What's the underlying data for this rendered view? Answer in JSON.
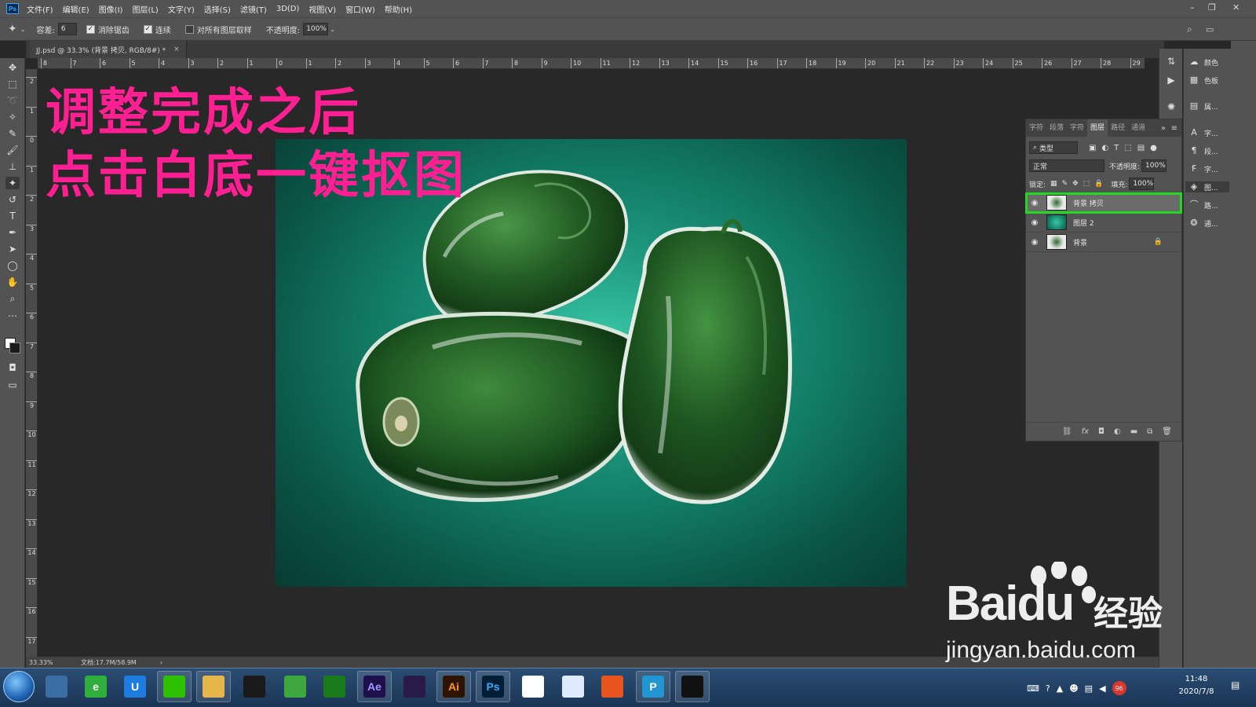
{
  "menubar": {
    "logo": "Ps",
    "items": [
      "文件(F)",
      "编辑(E)",
      "图像(I)",
      "图层(L)",
      "文字(Y)",
      "选择(S)",
      "滤镜(T)",
      "3D(D)",
      "视图(V)",
      "窗口(W)",
      "帮助(H)"
    ]
  },
  "options": {
    "tolerance_label": "容差:",
    "tolerance_value": "6",
    "antialias_label": "消除锯齿",
    "contiguous_label": "连续",
    "sample_all_label": "对所有图层取样",
    "opacity_label": "不透明度:",
    "opacity_value": "100%"
  },
  "document": {
    "tab_title": "JJ.psd @ 33.3% (背景 拷贝, RGB/8#) *",
    "close": "×",
    "zoom": "33.33%",
    "doc_size": "文档:17.7M/58.9M"
  },
  "rulers": {
    "top": [
      "8",
      "7",
      "6",
      "5",
      "4",
      "3",
      "2",
      "1",
      "0",
      "1",
      "2",
      "3",
      "4",
      "5",
      "6",
      "7",
      "8",
      "9",
      "10",
      "11",
      "12",
      "13",
      "14",
      "15",
      "16",
      "17",
      "18",
      "19",
      "20",
      "21",
      "22",
      "23",
      "24",
      "25",
      "26",
      "27",
      "28",
      "29"
    ],
    "left": [
      "2",
      "1",
      "0",
      "1",
      "2",
      "3",
      "4",
      "5",
      "6",
      "7",
      "8",
      "9",
      "10",
      "11",
      "12",
      "13",
      "14",
      "15",
      "16",
      "17"
    ]
  },
  "overlay": {
    "line1": "调整完成之后",
    "line2": "点击白底一键抠图",
    "color": "#ff1f92"
  },
  "right_panels": [
    {
      "label": "颜色",
      "icon": "palette-icon"
    },
    {
      "label": "色板",
      "icon": "grid-icon"
    },
    {
      "label": "属...",
      "icon": "properties-icon"
    },
    {
      "label": "字...",
      "icon": "character-icon"
    },
    {
      "label": "段...",
      "icon": "paragraph-icon"
    },
    {
      "label": "字...",
      "icon": "glyphs-icon"
    },
    {
      "label": "图...",
      "icon": "layers-icon"
    },
    {
      "label": "路...",
      "icon": "paths-icon"
    },
    {
      "label": "通...",
      "icon": "channels-icon"
    }
  ],
  "layers_panel": {
    "tabs": [
      "字符",
      "段落",
      "字符",
      "图层",
      "路径",
      "通道"
    ],
    "active_tab": "图层",
    "filter_kind": "类型",
    "blend_mode": "正常",
    "opacity_label": "不透明度:",
    "opacity_value": "100%",
    "lock_label": "锁定:",
    "fill_label": "填充:",
    "fill_value": "100%",
    "layers": [
      {
        "name": "背景 拷贝",
        "selected": true,
        "locked": false
      },
      {
        "name": "图层 2",
        "selected": false,
        "locked": false
      },
      {
        "name": "背景",
        "selected": false,
        "locked": true
      }
    ],
    "footer_icons": [
      "link-icon",
      "fx-icon",
      "mask-icon",
      "adjustment-icon",
      "folder-icon",
      "new-layer-icon",
      "trash-icon"
    ],
    "highlight_color": "#22d822"
  },
  "watermark": {
    "brand": "Baidu",
    "brand_cn": "经验",
    "url": "jingyan.baidu.com"
  },
  "taskbar": {
    "apps": [
      {
        "name": "calculator",
        "label": "",
        "bg": "#3a6ea5"
      },
      {
        "name": "browser-360",
        "label": "e",
        "bg": "#2fae3b"
      },
      {
        "name": "baidu-netdisk",
        "label": "U",
        "bg": "#1e7be0"
      },
      {
        "name": "wechat",
        "label": "",
        "bg": "#2dc100"
      },
      {
        "name": "explorer",
        "label": "",
        "bg": "#e6b64a"
      },
      {
        "name": "qq",
        "label": "",
        "bg": "#1a1a1a"
      },
      {
        "name": "green-app",
        "label": "",
        "bg": "#3da63d"
      },
      {
        "name": "pen-app",
        "label": "",
        "bg": "#1b7a1b"
      },
      {
        "name": "after-effects",
        "label": "Ae",
        "bg": "#1f0f4a"
      },
      {
        "name": "premiere",
        "label": "",
        "bg": "#2a1a4a"
      },
      {
        "name": "illustrator",
        "label": "Ai",
        "bg": "#2e1400"
      },
      {
        "name": "photoshop",
        "label": "Ps",
        "bg": "#001e36"
      },
      {
        "name": "colorful-app",
        "label": "",
        "bg": "#ffffff"
      },
      {
        "name": "feishu",
        "label": "",
        "bg": "#dfe9ff"
      },
      {
        "name": "video-app",
        "label": "",
        "bg": "#e8541e"
      },
      {
        "name": "pdf-app",
        "label": "P",
        "bg": "#2196d3"
      },
      {
        "name": "dark-app",
        "label": "",
        "bg": "#111111"
      }
    ],
    "time": "11:48",
    "date": "2020/7/8",
    "badge": "96"
  }
}
